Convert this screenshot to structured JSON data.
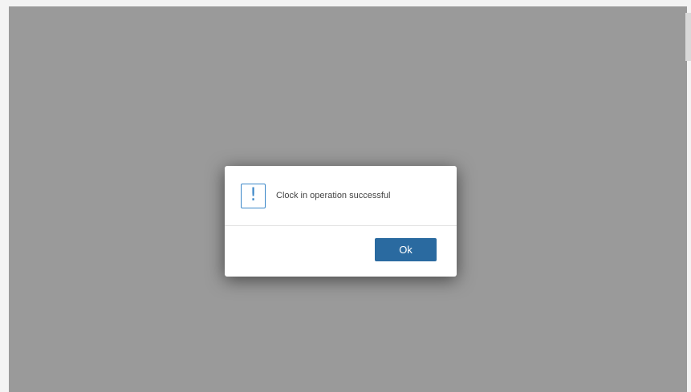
{
  "dialog": {
    "icon": "exclamation-icon",
    "icon_glyph": "!",
    "message": "Clock in operation successful",
    "ok_label": "Ok"
  },
  "colors": {
    "overlay": "#9a9a9a",
    "button": "#2a6aa0",
    "icon": "#3a86c8"
  }
}
